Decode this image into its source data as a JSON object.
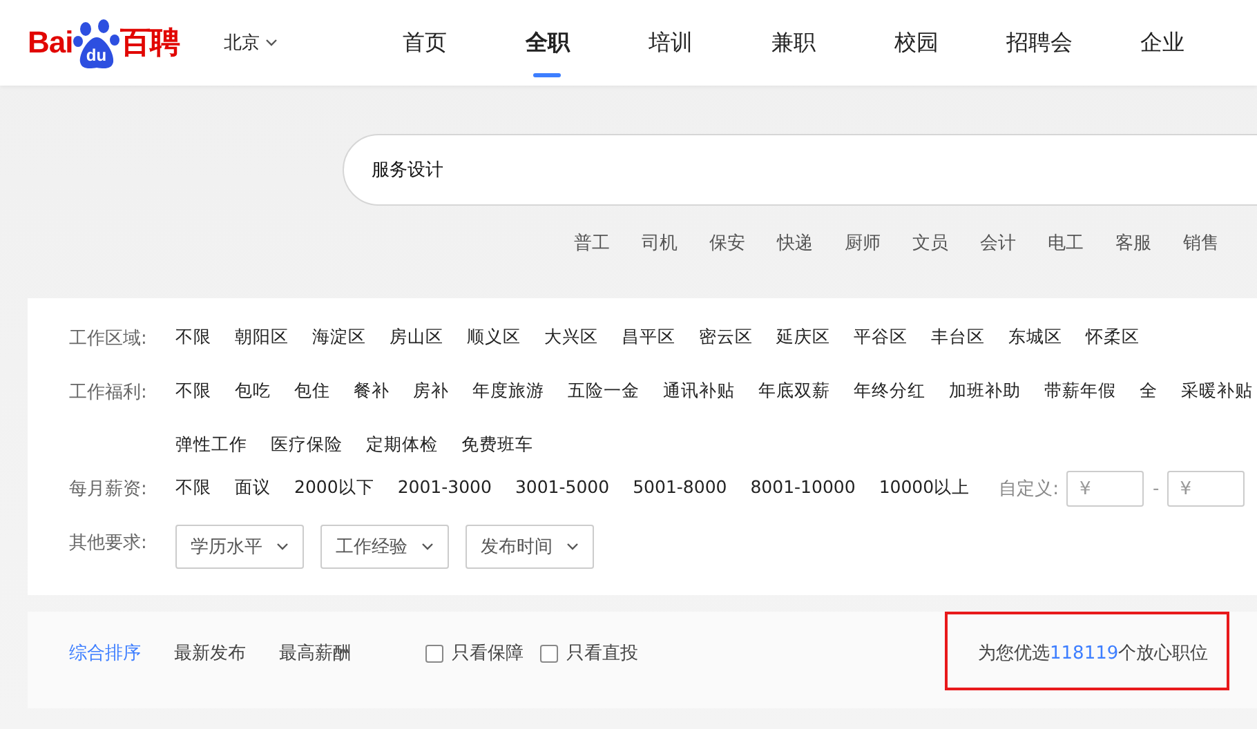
{
  "logo": {
    "latin": "Bai",
    "paw": "du",
    "cjk": "百聘"
  },
  "city": {
    "label": "北京"
  },
  "nav": [
    {
      "label": "首页",
      "selected": false
    },
    {
      "label": "全职",
      "selected": true
    },
    {
      "label": "培训",
      "selected": false
    },
    {
      "label": "兼职",
      "selected": false
    },
    {
      "label": "校园",
      "selected": false
    },
    {
      "label": "招聘会",
      "selected": false
    },
    {
      "label": "企业",
      "selected": false
    }
  ],
  "search": {
    "value": "服务设计"
  },
  "hot_tags": [
    "普工",
    "司机",
    "保安",
    "快递",
    "厨师",
    "文员",
    "会计",
    "电工",
    "客服",
    "销售"
  ],
  "filters": [
    {
      "label": "工作区域:",
      "options": [
        "不限",
        "朝阳区",
        "海淀区",
        "房山区",
        "顺义区",
        "大兴区",
        "昌平区",
        "密云区",
        "延庆区",
        "平谷区",
        "丰台区",
        "东城区",
        "怀柔区"
      ]
    },
    {
      "label": "工作福利:",
      "options": [
        "不限",
        "包吃",
        "包住",
        "餐补",
        "房补",
        "年度旅游",
        "五险一金",
        "通讯补贴",
        "年底双薪",
        "年终分红",
        "加班补助",
        "带薪年假",
        "全",
        "采暖补贴",
        "弹性工作",
        "医疗保险",
        "定期体检",
        "免费班车"
      ]
    },
    {
      "label": "每月薪资:",
      "options": [
        "不限",
        "面议",
        "2000以下",
        "2001-3000",
        "3001-5000",
        "5001-8000",
        "8001-10000",
        "10000以上"
      ],
      "custom": {
        "label": "自定义:",
        "min_placeholder": "¥",
        "separator": "-",
        "max_placeholder": "¥"
      }
    }
  ],
  "other": {
    "label": "其他要求:",
    "dropdowns": [
      "学历水平",
      "工作经验",
      "发布时间"
    ]
  },
  "sort": [
    {
      "label": "综合排序",
      "selected": true
    },
    {
      "label": "最新发布",
      "selected": false
    },
    {
      "label": "最高薪酬",
      "selected": false
    }
  ],
  "checks": [
    {
      "label": "只看保障",
      "checked": false
    },
    {
      "label": "只看直投",
      "checked": false
    }
  ],
  "result": {
    "prefix": "为您优选",
    "count": "118119",
    "suffix": "个放心职位",
    "highlighted": true
  }
}
